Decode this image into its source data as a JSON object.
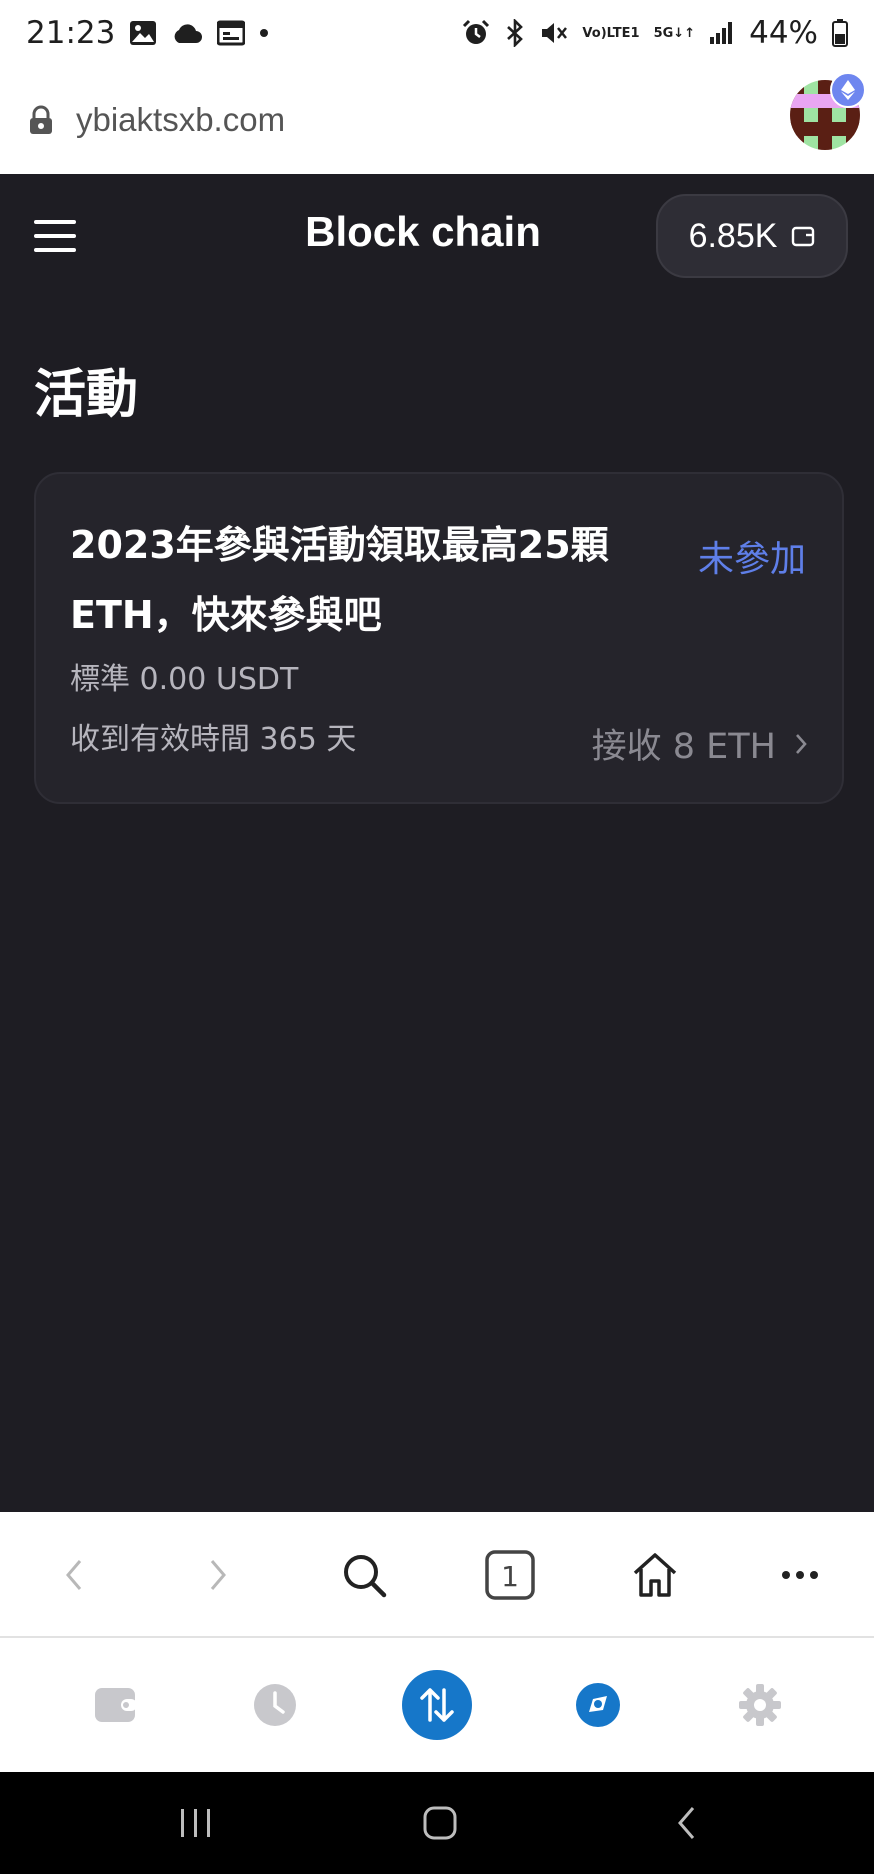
{
  "status_bar": {
    "time": "21:23",
    "network_top": "Vo)",
    "network_bottom": "LTE1",
    "signal_5g_top": "5G",
    "signal_5g_bottom": "↓↑",
    "battery": "44%"
  },
  "url_bar": {
    "url": "ybiaktsxb.com"
  },
  "header": {
    "title": "Block chain",
    "balance": "6.85K"
  },
  "page": {
    "heading": "活動"
  },
  "campaign": {
    "title": "2023年參與活動領取最高25顆ETH，快來參與吧",
    "status": "未參加",
    "standard": "標準 0.00 USDT",
    "validity": "收到有效時間 365 天",
    "receive": "接收 8 ETH"
  },
  "browser_toolbar": {
    "tab_count": "1"
  },
  "colors": {
    "background": "#1e1d23",
    "card": "#25242b",
    "accent": "#5f7fe9",
    "primary_blue": "#1677c9"
  },
  "icons": {
    "status": [
      "gallery-icon",
      "cloud-icon",
      "calendar-icon",
      "alarm-icon",
      "bluetooth-icon",
      "mute-icon",
      "signal-icon",
      "battery-icon"
    ],
    "app_nav": [
      "wallet-icon",
      "history-clock-icon",
      "swap-arrows-icon",
      "discover-compass-icon",
      "settings-gear-icon"
    ]
  }
}
